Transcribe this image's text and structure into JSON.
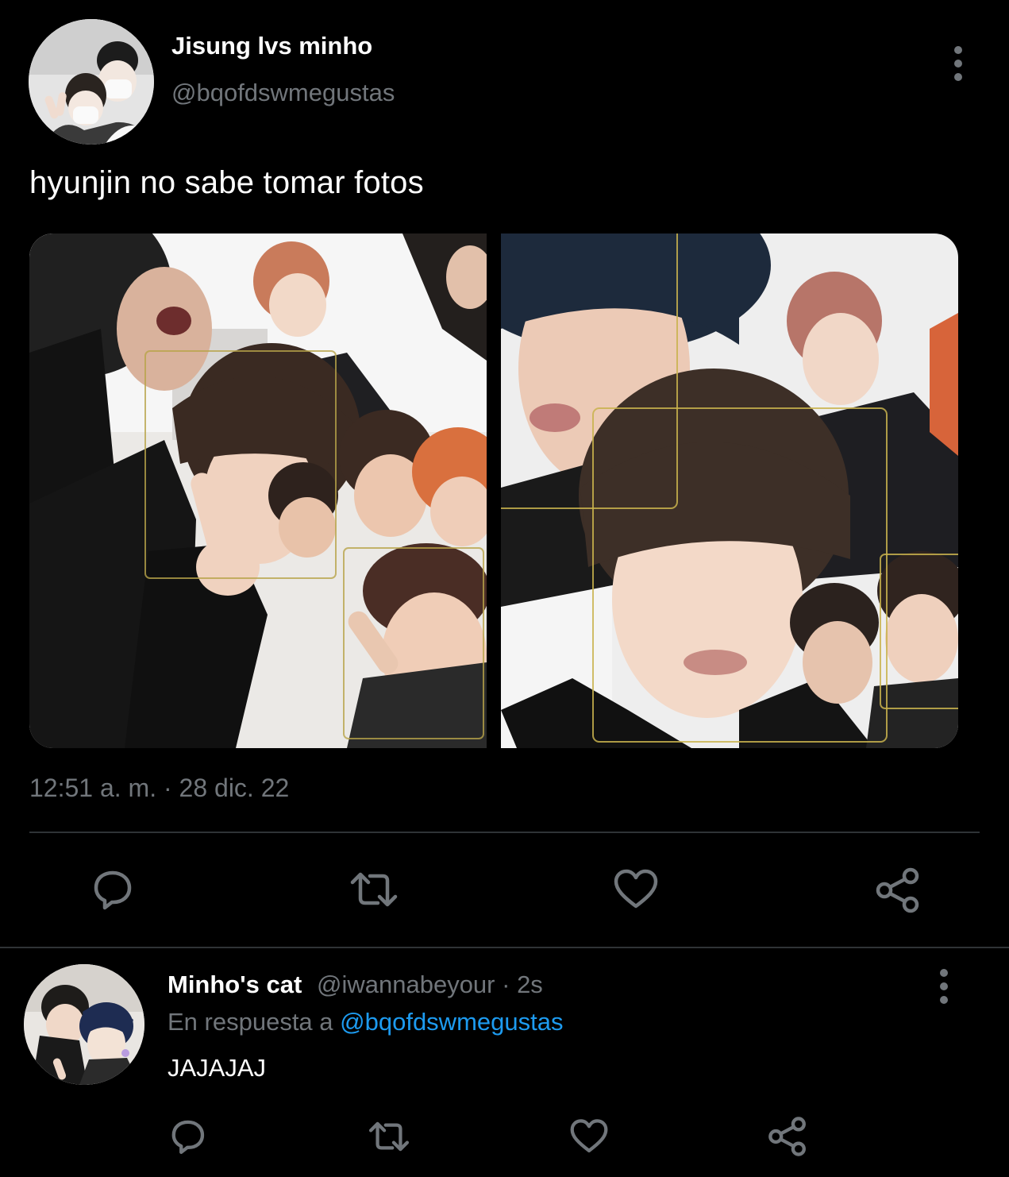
{
  "tweet": {
    "author_name": "Jisung lvs minho",
    "author_handle": "@bqofdswmegustas",
    "text": "hyunjin no sabe tomar fotos",
    "timestamp": "12:51 a. m. · 28 dic. 22",
    "media_count": 2,
    "actions": [
      "reply-icon",
      "retweet-icon",
      "like-icon",
      "share-icon"
    ]
  },
  "reply": {
    "author_name": "Minho's cat",
    "author_handle": "@iwannabeyour",
    "separator": " · ",
    "time": "2s",
    "context_prefix": "En respuesta a ",
    "context_handle": "@bqofdswmegustas",
    "text": "JAJAJAJ",
    "actions": [
      "reply-icon",
      "retweet-icon",
      "like-icon",
      "share-icon"
    ]
  },
  "colors": {
    "background": "#000000",
    "text_primary": "#ffffff",
    "text_secondary": "#71767b",
    "link": "#1d9bf0",
    "divider": "#2f3336"
  }
}
